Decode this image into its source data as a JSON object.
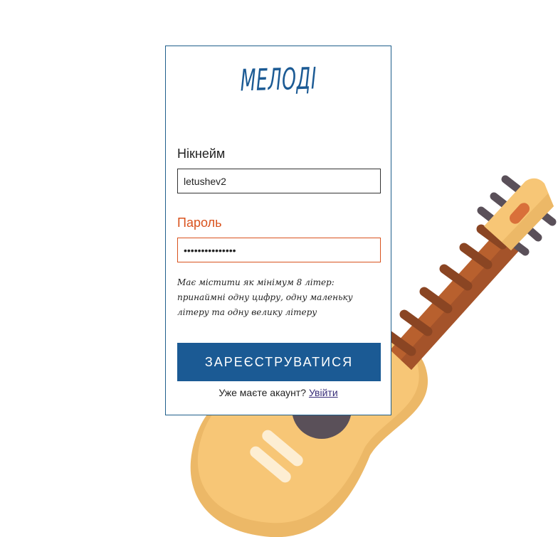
{
  "brand": {
    "logo_text": "МЕЛОДІ"
  },
  "form": {
    "nickname": {
      "label": "Нікнейм",
      "value": "letushev2"
    },
    "password": {
      "label": "Пароль",
      "value": "•••••••••••••••",
      "state": "error"
    },
    "password_hint": "Має містити як мінімум 8 літер: принаймні одну цифру, одну маленьку літеру та одну велику літеру",
    "submit_label": "ЗАРЕЄСТРУВАТИСЯ",
    "login_prompt": "Уже маєте акаунт?",
    "login_link": "Увійти"
  },
  "colors": {
    "brand_blue": "#1b5a94",
    "error_orange": "#d9531e",
    "guitar_body": "#f7c676",
    "guitar_neck": "#b8602e",
    "guitar_head": "#f7c676",
    "guitar_hole": "#5a5059"
  },
  "icons": {
    "background_illustration": "guitar-illustration"
  }
}
